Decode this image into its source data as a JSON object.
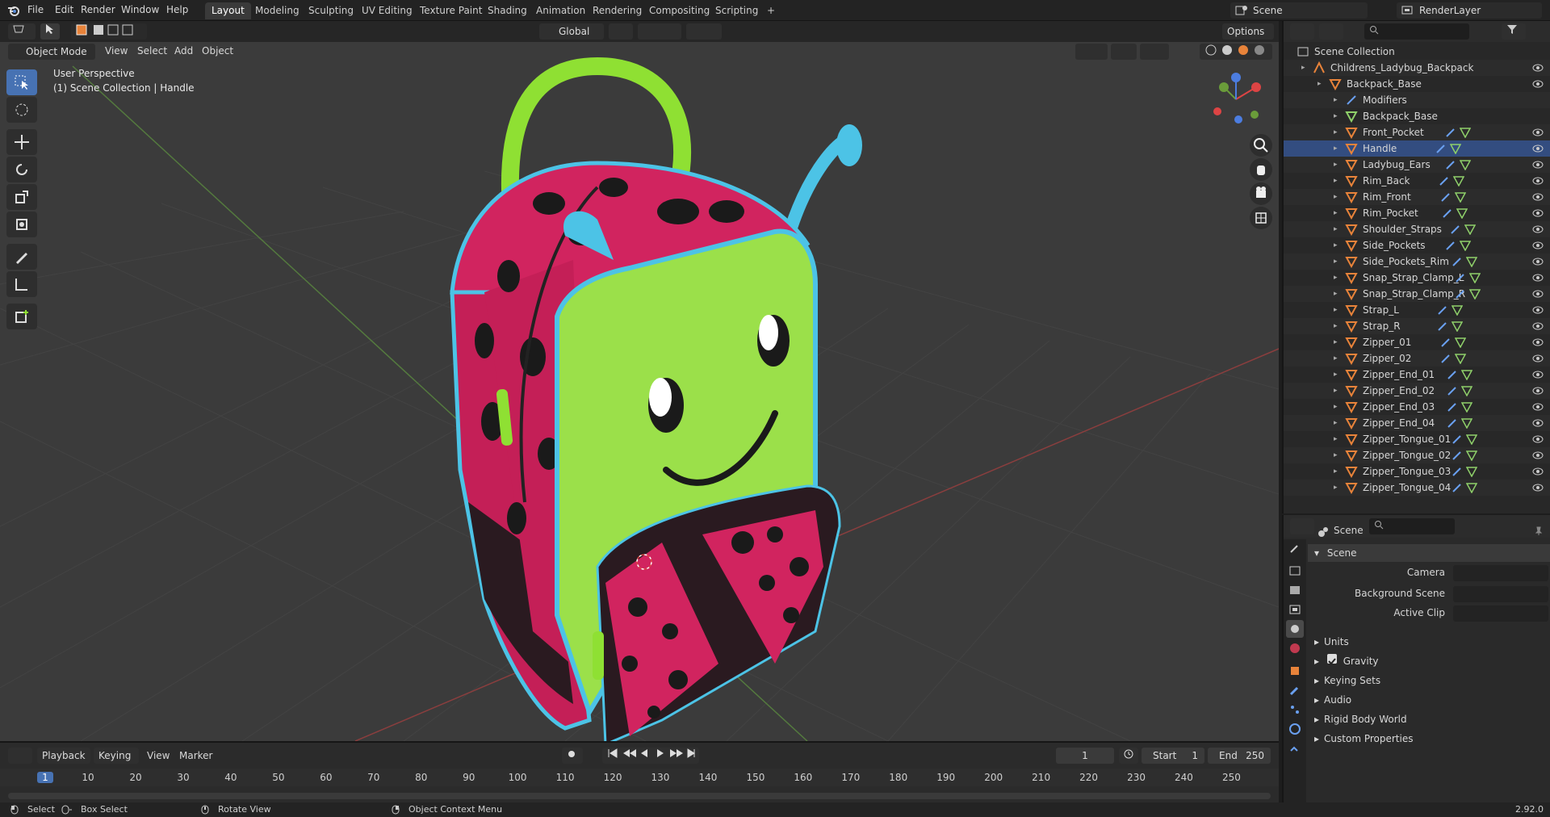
{
  "menubar": {
    "items": [
      "File",
      "Edit",
      "Render",
      "Window",
      "Help"
    ],
    "workspaces": [
      "Layout",
      "Modeling",
      "Sculpting",
      "UV Editing",
      "Texture Paint",
      "Shading",
      "Animation",
      "Rendering",
      "Compositing",
      "Scripting"
    ],
    "active_workspace": "Layout",
    "add_tab": "+",
    "scene_name": "Scene",
    "view_layer": "RenderLayer"
  },
  "viewport_header": {
    "mode": "Object Mode",
    "menus": [
      "View",
      "Select",
      "Add",
      "Object"
    ],
    "transform_orientation": "Global",
    "options": "Options"
  },
  "viewport": {
    "view_name": "User Perspective",
    "context": "(1) Scene Collection | Handle"
  },
  "outliner": {
    "root": "Scene Collection",
    "collection": "Childrens_Ladybug_Backpack",
    "parent": "Backpack_Base",
    "modifiers": "Modifiers",
    "mesh_data": "Backpack_Base",
    "objects": [
      "Front_Pocket",
      "Handle",
      "Ladybug_Ears",
      "Rim_Back",
      "Rim_Front",
      "Rim_Pocket",
      "Shoulder_Straps",
      "Side_Pockets",
      "Side_Pockets_Rim",
      "Snap_Strap_Clamp_L",
      "Snap_Strap_Clamp_R",
      "Strap_L",
      "Strap_R",
      "Zipper_01",
      "Zipper_02",
      "Zipper_End_01",
      "Zipper_End_02",
      "Zipper_End_03",
      "Zipper_End_04",
      "Zipper_Tongue_01",
      "Zipper_Tongue_02",
      "Zipper_Tongue_03",
      "Zipper_Tongue_04"
    ]
  },
  "properties": {
    "context": "Scene",
    "panel": "Scene",
    "fields": {
      "camera": "Camera",
      "background_scene": "Background Scene",
      "active_clip": "Active Clip"
    },
    "sections": [
      "Units",
      "Gravity",
      "Keying Sets",
      "Audio",
      "Rigid Body World",
      "Custom Properties"
    ],
    "gravity_enabled": true
  },
  "timeline": {
    "menus": [
      "Playback",
      "Keying",
      "View",
      "Marker"
    ],
    "current_frame": "1",
    "start_label": "Start",
    "start": "1",
    "end_label": "End",
    "end": "250",
    "ticks": [
      "1",
      "10",
      "20",
      "30",
      "40",
      "50",
      "60",
      "70",
      "80",
      "90",
      "100",
      "110",
      "120",
      "130",
      "140",
      "150",
      "160",
      "170",
      "180",
      "190",
      "200",
      "210",
      "220",
      "230",
      "240",
      "250"
    ]
  },
  "statusbar": {
    "select": "Select",
    "box_select": "Box Select",
    "rotate_view": "Rotate View",
    "context_menu": "Object Context Menu",
    "version": "2.92.0"
  },
  "colors": {
    "accent": "#4772b3",
    "selected_row": "#334d80",
    "object_orange": "#e8833a",
    "ladybug_pink": "#d1245f",
    "lime_green": "#9be04a",
    "cyan_trim": "#4cc3e6"
  }
}
